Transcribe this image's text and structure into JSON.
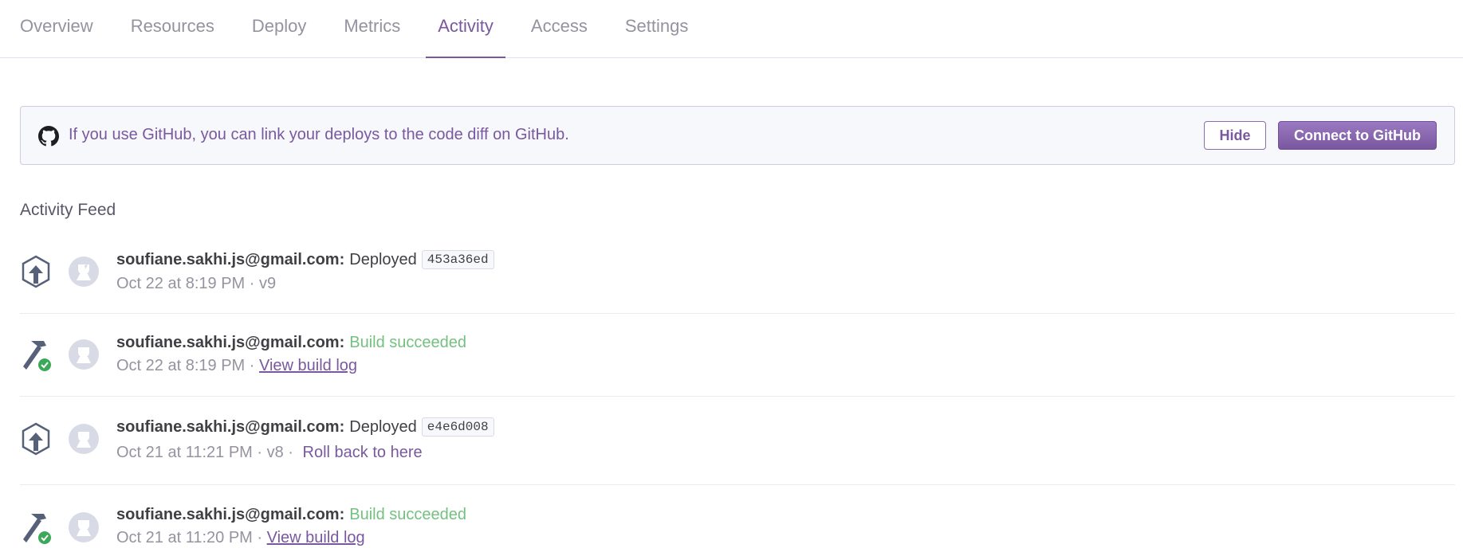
{
  "tabs": [
    {
      "label": "Overview"
    },
    {
      "label": "Resources"
    },
    {
      "label": "Deploy"
    },
    {
      "label": "Metrics"
    },
    {
      "label": "Activity",
      "active": true
    },
    {
      "label": "Access"
    },
    {
      "label": "Settings"
    }
  ],
  "banner": {
    "text": "If you use GitHub, you can link your deploys to the code diff on GitHub.",
    "hide_label": "Hide",
    "connect_label": "Connect to GitHub",
    "icon": "github-icon"
  },
  "feed": {
    "title": "Activity Feed",
    "items": [
      {
        "type": "deploy",
        "icon": "deploy-arrow-icon",
        "email": "soufiane.sakhi.js@gmail.com:",
        "action": "Deployed",
        "commit": "453a36ed",
        "time": "Oct 22 at 8:19 PM",
        "version": "v9"
      },
      {
        "type": "build",
        "icon": "hammer-check-icon",
        "email": "soufiane.sakhi.js@gmail.com:",
        "action": "Build succeeded",
        "time": "Oct 22 at 8:19 PM",
        "link": "View build log"
      },
      {
        "type": "deploy",
        "icon": "deploy-arrow-icon",
        "email": "soufiane.sakhi.js@gmail.com:",
        "action": "Deployed",
        "commit": "e4e6d008",
        "time": "Oct 21 at 11:21 PM",
        "version": "v8",
        "rollback": "Roll back to here"
      },
      {
        "type": "build",
        "icon": "hammer-check-icon",
        "email": "soufiane.sakhi.js@gmail.com:",
        "action": "Build succeeded",
        "time": "Oct 21 at 11:20 PM",
        "link": "View build log"
      }
    ]
  },
  "colors": {
    "accent": "#79589f",
    "success": "#74c080",
    "muted": "#96929f"
  }
}
